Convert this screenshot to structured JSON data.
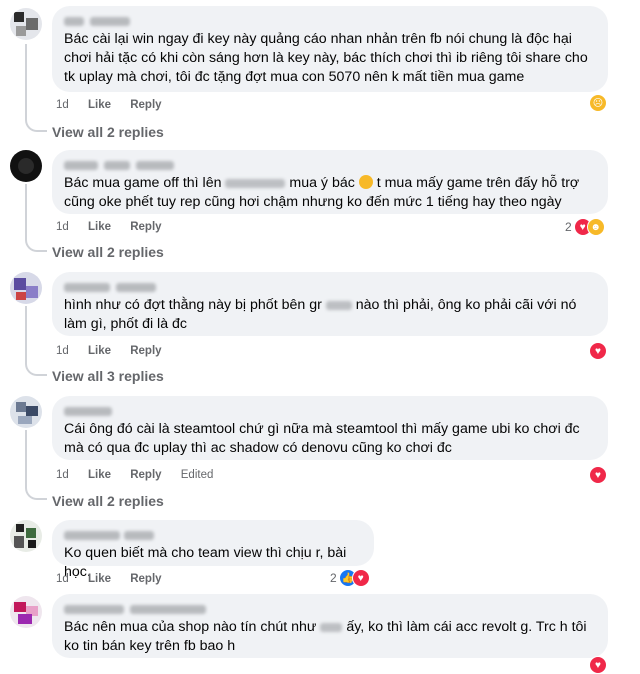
{
  "colors": {
    "bubble": "#f0f2f5",
    "meta": "#65676b",
    "heart": "#f02849",
    "like": "#1877f2",
    "emoji": "#f7b928"
  },
  "comments": [
    {
      "text": "Bác cài lại win ngay đi key này quảng cáo nhan nhản trên fb nói chung là độc hại chơi hải tặc có khi còn sáng hơn là key này, bác thích chơi thì ib riêng tôi share cho tk uplay mà chơi, tôi đc tặng đợt mua con 5070 nên k mất tiền mua game",
      "time": "1d",
      "like": "Like",
      "reply": "Reply",
      "reaction": "sad-emoji-icon",
      "view_replies": "View all 2 replies"
    },
    {
      "text_a": "Bác mua game off thì lên",
      "text_b": "mua ý bác",
      "text_c": "t mua mấy game trên đấy hỗ trợ cũng oke phết tuy rep cũng hơi chậm nhưng ko đến mức 1 tiếng hay theo ngày",
      "time": "1d",
      "like": "Like",
      "reply": "Reply",
      "reaction_count": "2",
      "view_replies": "View all 2 replies"
    },
    {
      "text_a": "hình như có đợt thằng này bị phốt bên gr",
      "text_b": "nào thì phải, ông ko phải cãi với nó làm gì, phốt đi là đc",
      "time": "1d",
      "like": "Like",
      "reply": "Reply",
      "view_replies": "View all 3 replies"
    },
    {
      "text": "Cái ông đó cài là steamtool chứ gì nữa mà steamtool thì mấy game ubi ko chơi đc mà có qua đc uplay thì ac shadow có denovu cũng ko chơi đc",
      "time": "1d",
      "like": "Like",
      "reply": "Reply",
      "edited": "Edited",
      "view_replies": "View all 2 replies"
    },
    {
      "text": "Ko quen biết mà cho team view thì chịu r, bài học.",
      "time": "1d",
      "like": "Like",
      "reply": "Reply",
      "reaction_count": "2"
    },
    {
      "text_a": "Bác nên mua của shop nào tín chút như",
      "text_b": "ấy, ko thì làm cái acc revolt g. Trc h tôi ko tin bán key trên fb bao h"
    }
  ]
}
